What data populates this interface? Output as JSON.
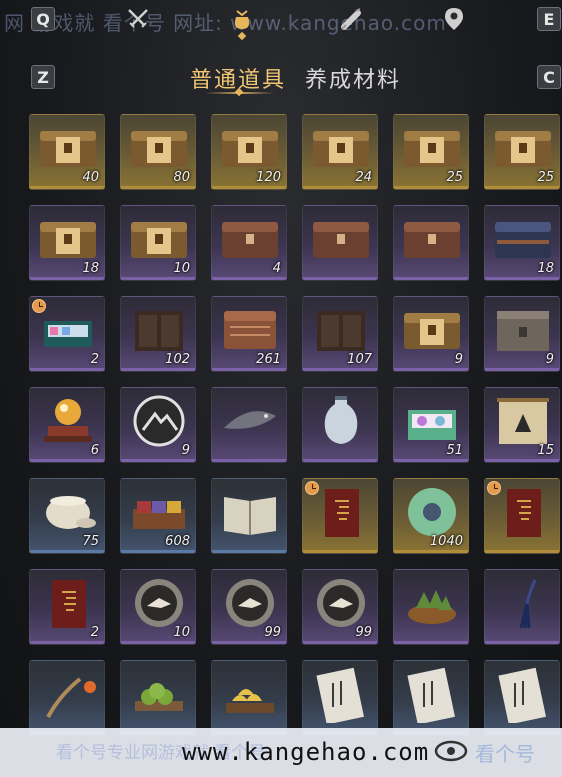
{
  "topbar": {
    "left_key": "Q",
    "right_key": "E",
    "watermark": "网 游戏就 看个号 网址: www.kangehao.com",
    "tabs": [
      {
        "icon": "sword-icon"
      },
      {
        "icon": "money-pouch-icon",
        "active": true
      },
      {
        "icon": "scroll-icon"
      },
      {
        "icon": "map-pin-icon"
      }
    ]
  },
  "categories": {
    "left_key": "Z",
    "right_key": "C",
    "active": "普通道具",
    "inactive": "养成材料"
  },
  "colors": {
    "accent": "#f0c674",
    "rarity_gold": "#b08d3a",
    "rarity_purple": "#7b62a8",
    "rarity_blue": "#5b7aa8"
  },
  "items": [
    {
      "art": "gold-chest",
      "rarity": "gold",
      "qty": "40"
    },
    {
      "art": "gold-chest",
      "rarity": "gold",
      "qty": "80"
    },
    {
      "art": "gold-chest",
      "rarity": "gold",
      "qty": "120"
    },
    {
      "art": "gold-chest",
      "rarity": "gold",
      "qty": "24"
    },
    {
      "art": "gold-chest",
      "rarity": "gold",
      "qty": "25"
    },
    {
      "art": "gold-chest",
      "rarity": "gold",
      "qty": "25"
    },
    {
      "art": "gold-chest",
      "rarity": "purple",
      "qty": "18"
    },
    {
      "art": "gold-chest",
      "rarity": "purple",
      "qty": "10"
    },
    {
      "art": "copper-chest",
      "rarity": "purple",
      "qty": "4"
    },
    {
      "art": "copper-chest",
      "rarity": "purple",
      "qty": ""
    },
    {
      "art": "copper-chest",
      "rarity": "purple",
      "qty": ""
    },
    {
      "art": "blue-chest",
      "rarity": "purple",
      "qty": "18"
    },
    {
      "art": "gift-box",
      "rarity": "purple",
      "qty": "2",
      "timer": true
    },
    {
      "art": "dark-cabinet",
      "rarity": "purple",
      "qty": "102"
    },
    {
      "art": "carved-chest",
      "rarity": "purple",
      "qty": "261"
    },
    {
      "art": "dark-cabinet",
      "rarity": "purple",
      "qty": "107"
    },
    {
      "art": "gold-chest",
      "rarity": "purple",
      "qty": "9"
    },
    {
      "art": "stone-chest",
      "rarity": "purple",
      "qty": "9"
    },
    {
      "art": "orb-stand",
      "rarity": "purple",
      "qty": "6"
    },
    {
      "art": "mountain-emblem",
      "rarity": "purple",
      "qty": "9"
    },
    {
      "art": "ghost-fish",
      "rarity": "purple",
      "qty": ""
    },
    {
      "art": "porcelain-vase",
      "rarity": "purple",
      "qty": ""
    },
    {
      "art": "gift-box-green",
      "rarity": "purple",
      "qty": "51"
    },
    {
      "art": "painting-scroll",
      "rarity": "purple",
      "qty": "15"
    },
    {
      "art": "ceramic-jar",
      "rarity": "blue",
      "qty": "75"
    },
    {
      "art": "fabric-tray",
      "rarity": "blue",
      "qty": "608"
    },
    {
      "art": "open-book",
      "rarity": "blue",
      "qty": ""
    },
    {
      "art": "red-manual",
      "rarity": "gold",
      "qty": "",
      "timer": true
    },
    {
      "art": "jade-ring",
      "rarity": "gold",
      "qty": "1040"
    },
    {
      "art": "red-manual",
      "rarity": "gold",
      "qty": "",
      "timer": true
    },
    {
      "art": "red-manual",
      "rarity": "purple",
      "qty": "2"
    },
    {
      "art": "bird-token",
      "rarity": "purple",
      "qty": "10"
    },
    {
      "art": "bird-token",
      "rarity": "purple",
      "qty": "99"
    },
    {
      "art": "bird-token",
      "rarity": "purple",
      "qty": "99"
    },
    {
      "art": "zongzi-basket",
      "rarity": "purple",
      "qty": ""
    },
    {
      "art": "tassel",
      "rarity": "purple",
      "qty": ""
    },
    {
      "art": "lantern-staff",
      "rarity": "blue",
      "qty": ""
    },
    {
      "art": "green-dumplings",
      "rarity": "blue",
      "qty": ""
    },
    {
      "art": "gold-ingots",
      "rarity": "blue",
      "qty": ""
    },
    {
      "art": "letter",
      "rarity": "blue",
      "qty": ""
    },
    {
      "art": "letter",
      "rarity": "blue",
      "qty": ""
    },
    {
      "art": "letter",
      "rarity": "blue",
      "qty": ""
    }
  ],
  "banner": {
    "ghost_text": "看个号专业网游戏就 看个号",
    "url": "www.kangehao.com",
    "mark": "看个号"
  }
}
